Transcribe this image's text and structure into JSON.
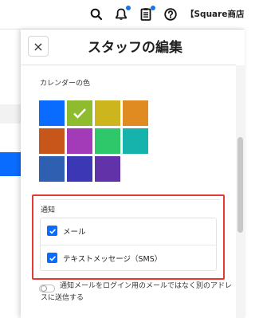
{
  "topbar": {
    "icons": [
      "search-icon",
      "bell-icon",
      "clipboard-icon",
      "help-icon"
    ],
    "store_name": "【Square商店"
  },
  "panel": {
    "close_glyph": "×",
    "title": "スタッフの編集",
    "calendar": {
      "label": "カレンダーの色",
      "colors": [
        {
          "hex": "#0a6cff",
          "selected": false
        },
        {
          "hex": "#8fbc2e",
          "selected": true
        },
        {
          "hex": "#cdb51e",
          "selected": false
        },
        {
          "hex": "#e08b22",
          "selected": false
        },
        {
          "hex": "#c8561a",
          "selected": false
        },
        {
          "hex": "#a33ab8",
          "selected": false
        },
        {
          "hex": "#2ec76a",
          "selected": false
        },
        {
          "hex": "#16b3ad",
          "selected": false
        },
        {
          "hex": "#2f5fb0",
          "selected": false
        },
        {
          "hex": "#3b37b5",
          "selected": false
        },
        {
          "hex": "#6232a8",
          "selected": false
        }
      ]
    },
    "notifications": {
      "label": "通知",
      "options": [
        {
          "label": "メール",
          "checked": true
        },
        {
          "label": "テキストメッセージ（SMS）",
          "checked": true
        }
      ],
      "toggle_text": "通知メールをログイン用のメールではなく別のアドレスに送信する",
      "toggle_on": false
    }
  },
  "accent_color": "#0a6cff",
  "highlight_color": "#e53935"
}
